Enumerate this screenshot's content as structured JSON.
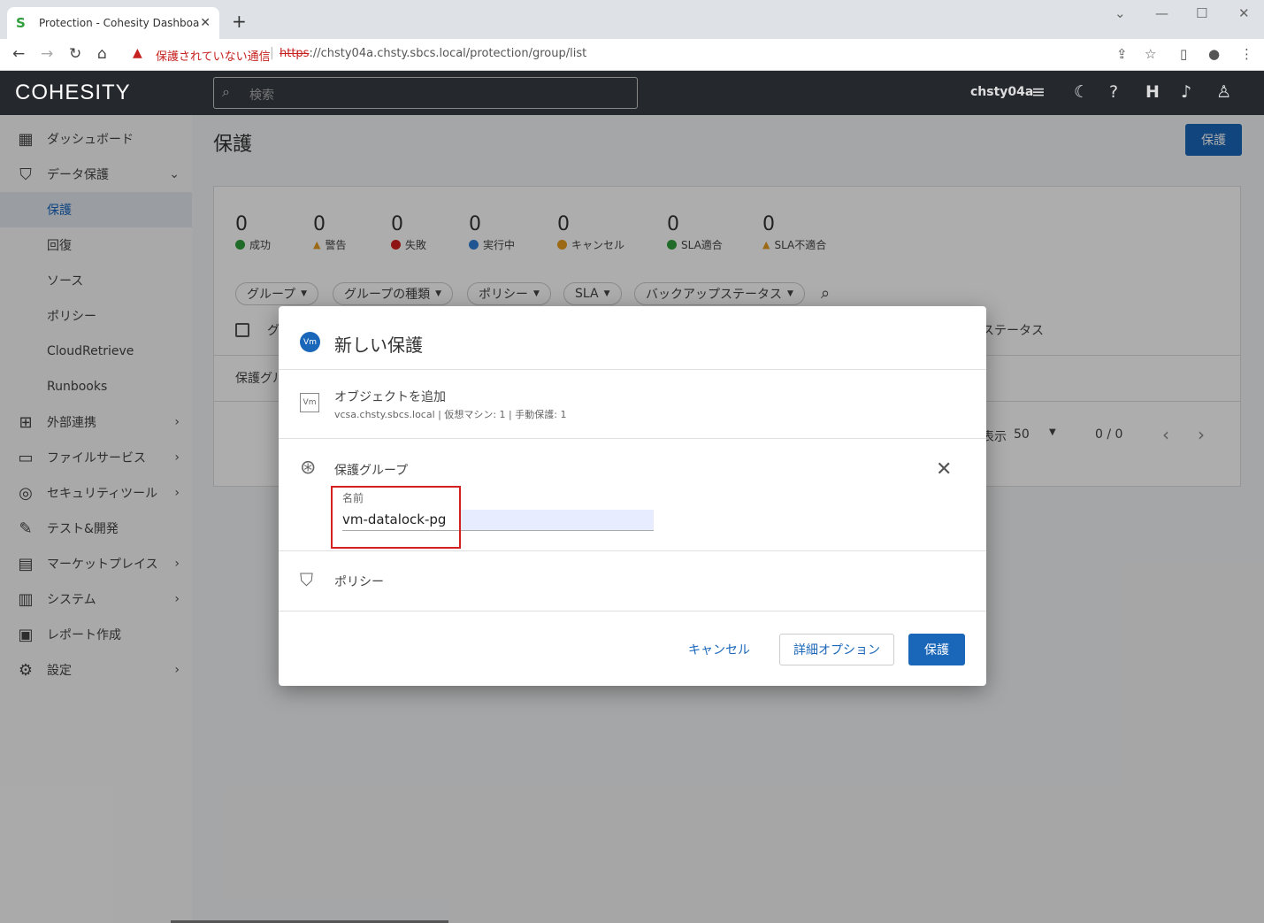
{
  "browser": {
    "tab_title": "Protection - Cohesity Dashboard",
    "tab_close": "✕",
    "new_tab": "+",
    "security_label": "保護されていない通信",
    "url_scheme": "https",
    "url_rest": "://chsty04a.chsty.sbcs.local/protection/group/list"
  },
  "app": {
    "logo": "COHESITY",
    "search_placeholder": "検索",
    "username": "chsty04a",
    "header_icons": [
      "filter-icon",
      "moon-icon",
      "help-icon",
      "helios-icon",
      "bell-icon",
      "user-icon"
    ]
  },
  "sidebar": {
    "items": [
      {
        "label": "ダッシュボード",
        "icon": "dashboard-icon"
      },
      {
        "label": "データ保護",
        "icon": "shield-check-icon",
        "expanded": true
      },
      {
        "label": "保護",
        "active": true
      },
      {
        "label": "回復"
      },
      {
        "label": "ソース"
      },
      {
        "label": "ポリシー"
      },
      {
        "label": "CloudRetrieve"
      },
      {
        "label": "Runbooks"
      },
      {
        "label": "外部連携",
        "icon": "hierarchy-icon"
      },
      {
        "label": "ファイルサービス",
        "icon": "folder-icon"
      },
      {
        "label": "セキュリティツール",
        "icon": "fingerprint-icon"
      },
      {
        "label": "テスト&開発",
        "icon": "wrench-icon"
      },
      {
        "label": "マーケットプレイス",
        "icon": "store-icon"
      },
      {
        "label": "システム",
        "icon": "system-icon"
      },
      {
        "label": "レポート作成",
        "icon": "report-icon"
      },
      {
        "label": "設定",
        "icon": "gear-icon"
      }
    ]
  },
  "main": {
    "title": "保護",
    "protect_button": "保護",
    "stats": [
      {
        "value": "0",
        "label": "成功",
        "color": "#2e9e3a"
      },
      {
        "value": "0",
        "label": "警告",
        "color": "#e69b1e"
      },
      {
        "value": "0",
        "label": "失敗",
        "color": "#d32020"
      },
      {
        "value": "0",
        "label": "実行中",
        "color": "#2f7fd6"
      },
      {
        "value": "0",
        "label": "キャンセル",
        "color": "#e69b1e"
      },
      {
        "value": "0",
        "label": "SLA適合",
        "color": "#2e9e3a"
      },
      {
        "value": "0",
        "label": "SLA不適合",
        "color": "#e69b1e"
      }
    ],
    "filters": [
      "グループ",
      "グループの種類",
      "ポリシー",
      "SLA",
      "バックアップステータス"
    ],
    "column_fragment": "グ",
    "status_column": "ステータス",
    "row_fragment": "保護グル",
    "page_size_label": "表示",
    "page_size": "50",
    "page_range": "0 / 0"
  },
  "dialog": {
    "badge": "Vm",
    "title": "新しい保護",
    "objects": {
      "title": "オブジェクトを追加",
      "subtitle": "vcsa.chsty.sbcs.local | 仮想マシン: 1 | 手動保護: 1"
    },
    "group": {
      "title": "保護グループ",
      "name_label": "名前",
      "name_value": "vm-datalock-pg"
    },
    "policy": {
      "title": "ポリシー"
    },
    "buttons": {
      "cancel": "キャンセル",
      "advanced": "詳細オプション",
      "protect": "保護"
    }
  }
}
